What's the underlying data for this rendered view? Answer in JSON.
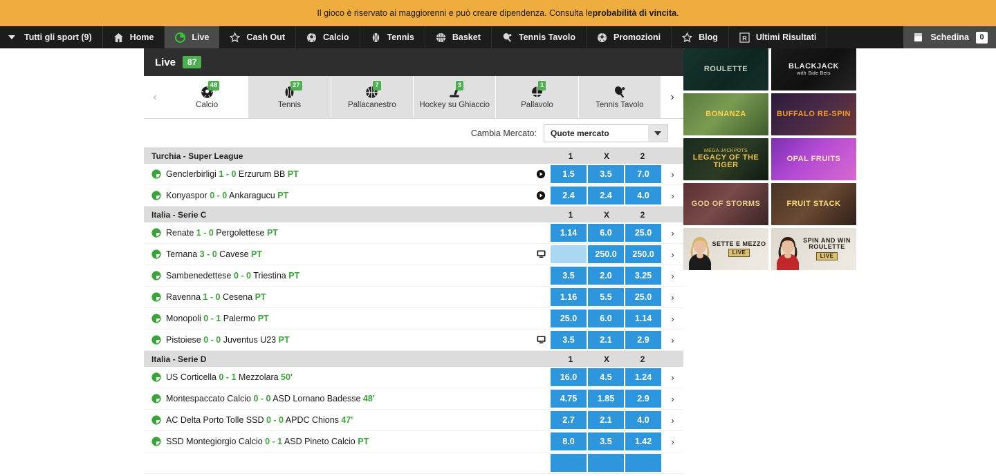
{
  "banner": {
    "text_before": "Il gioco è riservato ai maggiorenni e può creare dipendenza. Consulta le ",
    "link_text": "probabilità di vincita",
    "text_after": "."
  },
  "nav": {
    "all_sports": "Tutti gli sport (9)",
    "items": [
      {
        "label": "Home",
        "icon": "home-icon",
        "active": false
      },
      {
        "label": "Live",
        "icon": "live-clock-icon",
        "active": true
      },
      {
        "label": "Cash Out",
        "icon": "star-icon",
        "active": false
      },
      {
        "label": "Calcio",
        "icon": "football-icon",
        "active": false
      },
      {
        "label": "Tennis",
        "icon": "tennis-ball-icon",
        "active": false
      },
      {
        "label": "Basket",
        "icon": "basketball-icon",
        "active": false
      },
      {
        "label": "Tennis Tavolo",
        "icon": "table-tennis-icon",
        "active": false
      },
      {
        "label": "Promozioni",
        "icon": "football-icon",
        "active": false
      },
      {
        "label": "Blog",
        "icon": "star-icon",
        "active": false
      },
      {
        "label": "Ultimi Risultati",
        "icon": "results-r-icon",
        "active": false
      }
    ],
    "betslip_label": "Schedina",
    "betslip_count": "0"
  },
  "live_header": {
    "title": "Live",
    "count": "87"
  },
  "sport_tabs": {
    "prev_arrow": "‹",
    "next_arrow": "›",
    "items": [
      {
        "label": "Calcio",
        "count": "48",
        "icon": "football-icon",
        "active": true
      },
      {
        "label": "Tennis",
        "count": "27",
        "icon": "tennis-ball-icon",
        "active": false
      },
      {
        "label": "Pallacanestro",
        "count": "7",
        "icon": "basketball-icon",
        "active": false
      },
      {
        "label": "Hockey su Ghiaccio",
        "count": "3",
        "icon": "ice-hockey-icon",
        "active": false
      },
      {
        "label": "Pallavolo",
        "count": "1",
        "icon": "volleyball-icon",
        "active": false
      },
      {
        "label": "Tennis Tavolo",
        "count": "",
        "icon": "table-tennis-icon",
        "active": false
      }
    ]
  },
  "market": {
    "label": "Cambia Mercato:",
    "selected": "Quote mercato"
  },
  "table": {
    "columns": [
      "1",
      "X",
      "2"
    ],
    "leagues": [
      {
        "name": "Turchia - Super League",
        "events": [
          {
            "home": "Genclerbirligi",
            "score": "1 - 0",
            "away": "Erzurum BB",
            "period": "PT",
            "media": "play-circle-icon",
            "odds": [
              "1.5",
              "3.5",
              "7.0"
            ],
            "suspended": [
              false,
              false,
              false
            ]
          },
          {
            "home": "Konyaspor",
            "score": "0 - 0",
            "away": "Ankaragucu",
            "period": "PT",
            "media": "play-circle-icon",
            "odds": [
              "2.4",
              "2.4",
              "4.0"
            ],
            "suspended": [
              false,
              false,
              false
            ]
          }
        ]
      },
      {
        "name": "Italia - Serie C",
        "events": [
          {
            "home": "Renate",
            "score": "1 - 0",
            "away": "Pergolettese",
            "period": "PT",
            "media": "",
            "odds": [
              "1.14",
              "6.0",
              "25.0"
            ],
            "suspended": [
              false,
              false,
              false
            ]
          },
          {
            "home": "Ternana",
            "score": "3 - 0",
            "away": "Cavese",
            "period": "PT",
            "media": "tv-monitor-icon",
            "odds": [
              "",
              "250.0",
              "250.0"
            ],
            "suspended": [
              true,
              false,
              false
            ]
          },
          {
            "home": "Sambenedettese",
            "score": "0 - 0",
            "away": "Triestina",
            "period": "PT",
            "media": "",
            "odds": [
              "3.5",
              "2.0",
              "3.25"
            ],
            "suspended": [
              false,
              false,
              false
            ]
          },
          {
            "home": "Ravenna",
            "score": "1 - 0",
            "away": "Cesena",
            "period": "PT",
            "media": "",
            "odds": [
              "1.16",
              "5.5",
              "25.0"
            ],
            "suspended": [
              false,
              false,
              false
            ]
          },
          {
            "home": "Monopoli",
            "score": "0 - 1",
            "away": "Palermo",
            "period": "PT",
            "media": "",
            "odds": [
              "25.0",
              "6.0",
              "1.14"
            ],
            "suspended": [
              false,
              false,
              false
            ]
          },
          {
            "home": "Pistoiese",
            "score": "0 - 0",
            "away": "Juventus U23",
            "period": "PT",
            "media": "tv-monitor-icon",
            "odds": [
              "3.5",
              "2.1",
              "2.9"
            ],
            "suspended": [
              false,
              false,
              false
            ]
          }
        ]
      },
      {
        "name": "Italia - Serie D",
        "events": [
          {
            "home": "US Corticella",
            "score": "0 - 1",
            "away": "Mezzolara",
            "period": "50'",
            "media": "",
            "odds": [
              "16.0",
              "4.5",
              "1.24"
            ],
            "suspended": [
              false,
              false,
              false
            ]
          },
          {
            "home": "Montespaccato Calcio",
            "score": "0 - 0",
            "away": "ASD Lornano Badesse",
            "period": "48'",
            "media": "",
            "odds": [
              "4.75",
              "1.85",
              "2.9"
            ],
            "suspended": [
              false,
              false,
              false
            ]
          },
          {
            "home": "AC Delta Porto Tolle SSD",
            "score": "0 - 0",
            "away": "APDC Chions",
            "period": "47'",
            "media": "",
            "odds": [
              "2.7",
              "2.1",
              "4.0"
            ],
            "suspended": [
              false,
              false,
              false
            ]
          },
          {
            "home": "SSD Montegiorgio Calcio",
            "score": "0 - 1",
            "away": "ASD Pineto Calcio",
            "period": "PT",
            "media": "",
            "odds": [
              "8.0",
              "3.5",
              "1.42"
            ],
            "suspended": [
              false,
              false,
              false
            ]
          },
          {
            "home": "",
            "score": "",
            "away": "",
            "period": "",
            "media": "",
            "odds": [
              "",
              "",
              ""
            ],
            "suspended": [
              false,
              false,
              false
            ]
          }
        ]
      }
    ]
  },
  "casino": {
    "tiles": [
      {
        "title": "ROULETTE",
        "subtitle": "",
        "badge": "",
        "theme": "roulette"
      },
      {
        "title": "BLACKJACK",
        "subtitle": "with Side Bets",
        "badge": "",
        "theme": "blackjack"
      },
      {
        "title": "BONANZA",
        "subtitle": "",
        "badge": "",
        "theme": "bonanza"
      },
      {
        "title": "BUFFALO RE-SPIN",
        "subtitle": "",
        "badge": "",
        "theme": "buffalo"
      },
      {
        "title": "LEGACY OF THE TIGER",
        "subtitle": "MEGA JACKPOTS",
        "badge": "",
        "theme": "tiger"
      },
      {
        "title": "OPAL FRUITS",
        "subtitle": "",
        "badge": "",
        "theme": "opal"
      },
      {
        "title": "GOD OF STORMS",
        "subtitle": "",
        "badge": "",
        "theme": "storms"
      },
      {
        "title": "FRUIT STACK",
        "subtitle": "",
        "badge": "",
        "theme": "fruitstack"
      },
      {
        "title": "SETTE E MEZZO",
        "subtitle": "",
        "badge": "LIVE",
        "theme": "sette"
      },
      {
        "title": "SPIN AND WIN ROULETTE",
        "subtitle": "",
        "badge": "LIVE",
        "theme": "spinwin"
      }
    ]
  },
  "colors": {
    "banner": "#f0ad3f",
    "nav_bg": "#1c1c1c",
    "odds_blue": "#2e96dd",
    "odds_blue_suspended": "#a8d8f2",
    "badge_green": "#4caf50",
    "score_green": "#3aa33a",
    "league_head": "#dcdcdc"
  }
}
